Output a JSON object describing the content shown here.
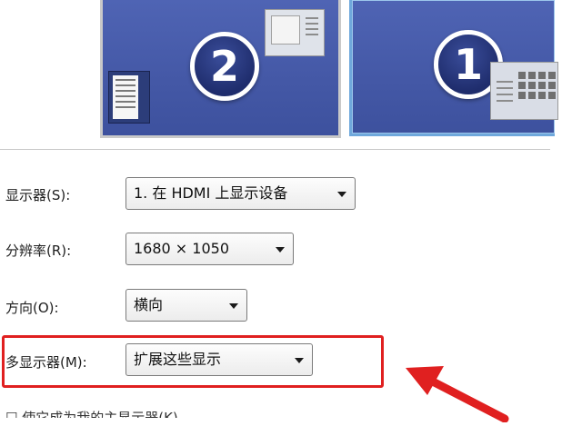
{
  "preview": {
    "monitor_2_number": "2",
    "monitor_1_number": "1"
  },
  "settings": {
    "display": {
      "label": "显示器(S):",
      "value": "1. 在 HDMI 上显示设备"
    },
    "resolution": {
      "label": "分辨率(R):",
      "value": "1680 × 1050"
    },
    "orientation": {
      "label": "方向(O):",
      "value": "横向"
    },
    "multiple_displays": {
      "label": "多显示器(M):",
      "value": "扩展这些显示"
    },
    "main_display_checkbox": {
      "label": "使它成为我的主显示器(K)"
    }
  },
  "colors": {
    "monitor_blue": "#4458a6",
    "highlight_red": "#e02020",
    "selected_border": "#6fa8dc"
  },
  "icons": [
    "monitor-2-icon",
    "monitor-1-icon",
    "dropdown-arrow-icon",
    "red-arrow-icon"
  ]
}
